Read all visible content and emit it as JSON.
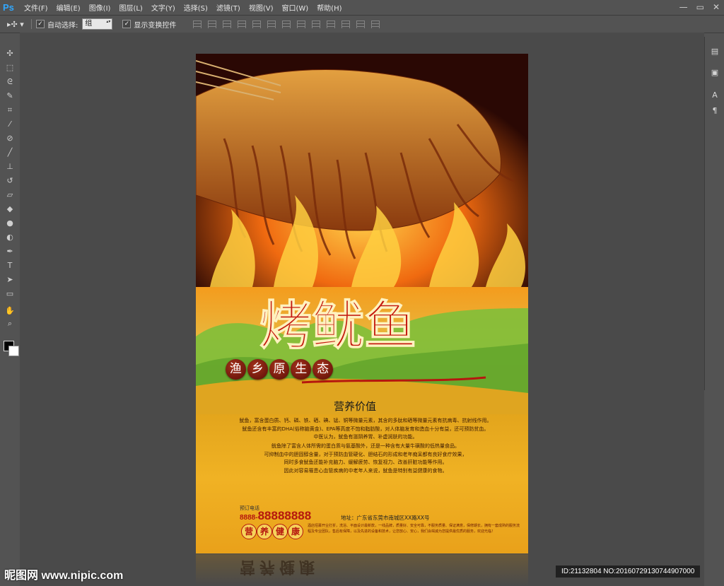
{
  "app": {
    "logo": "Ps"
  },
  "menu": {
    "items": [
      "文件(F)",
      "编辑(E)",
      "图像(I)",
      "图层(L)",
      "文字(Y)",
      "选择(S)",
      "滤镜(T)",
      "视图(V)",
      "窗口(W)",
      "帮助(H)"
    ]
  },
  "window_controls": {
    "minimize": "—",
    "restore": "▭",
    "close": "✕"
  },
  "options": {
    "tool_icon": "move-tool-icon",
    "auto_select_label": "自动选择:",
    "auto_select_checked": true,
    "auto_select_value": "组",
    "show_transform_label": "显示变换控件",
    "show_transform_checked": true
  },
  "tools": [
    "move",
    "marquee",
    "lasso",
    "quick-select",
    "crop",
    "eyedropper",
    "healing",
    "brush",
    "stamp",
    "history-brush",
    "eraser",
    "paint-bucket",
    "blur",
    "dodge",
    "pen",
    "type",
    "path-select",
    "shape",
    "hand",
    "zoom"
  ],
  "poster": {
    "title": "烤鱿鱼",
    "subtitle_chars": [
      "渔",
      "乡",
      "原",
      "生",
      "态"
    ],
    "nutrition_title": "营养价值",
    "paragraph1": "鱿鱼，富含蛋白质、钙、磷、铁、硒、碘、锰、铜等微量元素，其含的多肽和硒等微量元素有抗病毒、抗射线作用。\n鱿鱼还含有丰富的DHA(俗称脑黄金)、EPA等高度不饱和脂肪酸，对人体脑发育和造血十分有益，还可预防贫血。\n中医认为，鱿鱼有滋阴养胃、补虚润肤的功能。",
    "paragraph2": "鱿鱼除了富含人体所需的蛋白质与氨基酸外，还是一种含有大量牛磺酸的低热量食品。\n可抑制血中的胆固醇含量，对于预防血管硬化、胆结石的形成和老年痴呆都有良好食疗效果，\n同时多食鱿鱼还能补充脑力、缓解疲劳、恢复视力、改善肝脏功能等作用。\n因此对容易罹患心血管疾病的中老年人来说，鱿鱼是特别有益健康的食物。",
    "phone_label": "预订电话",
    "phone_prefix": "8888-",
    "phone_number": "88888888",
    "address": "地址：广东省东莞市南城区XX路XX号",
    "health_chars": [
      "营",
      "养",
      "健",
      "康"
    ],
    "promo_text": "酒店招募开业打折，洗浴、平面设计最新款，一线品牌，质量好、安全可靠，不服务质量、保证满意，保修期长，拥有一套成熟的服务流程及专业团队，售后有保障，以及先进的设备和技术，让您放心、安心，我们会竭诚为您提供最优质的服务，欢迎光临！"
  },
  "reflection_text": "营养健康",
  "watermark": {
    "site": "昵图网 www.nipic.com",
    "id": "ID:21132804 NO:20160729130744907000"
  }
}
